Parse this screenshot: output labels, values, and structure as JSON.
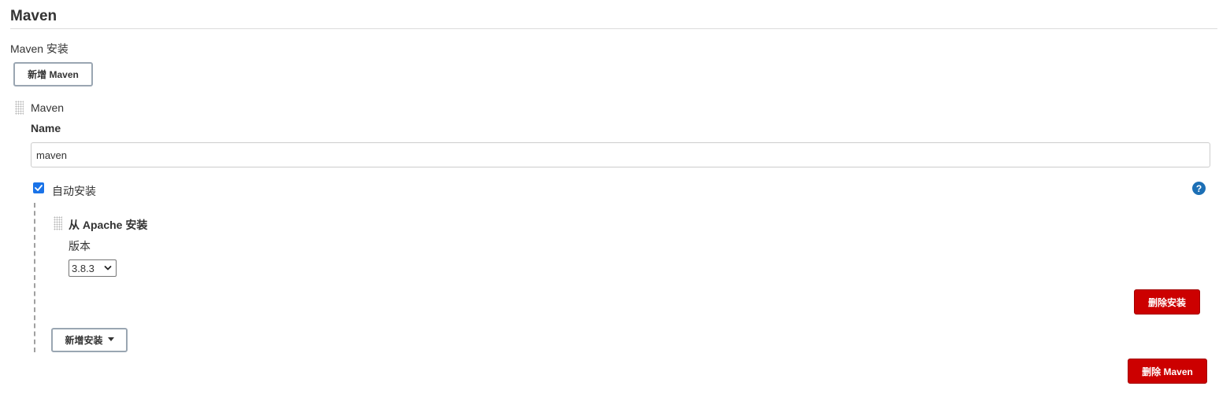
{
  "section": {
    "title": "Maven",
    "subsection_title": "Maven 安装",
    "add_button": "新增 Maven"
  },
  "installation": {
    "header": "Maven",
    "name_label": "Name",
    "name_value": "maven",
    "auto_install_label": "自动安装",
    "auto_install_checked": true,
    "help_icon": "?",
    "installer": {
      "title": "从 Apache 安装",
      "version_label": "版本",
      "version_selected": "3.8.3",
      "delete_button": "删除安装"
    },
    "add_installer_button": "新增安装",
    "delete_button": "删除 Maven"
  },
  "colors": {
    "danger": "#cc0000",
    "help": "#1c6fb5",
    "checkbox": "#1a73e8"
  }
}
